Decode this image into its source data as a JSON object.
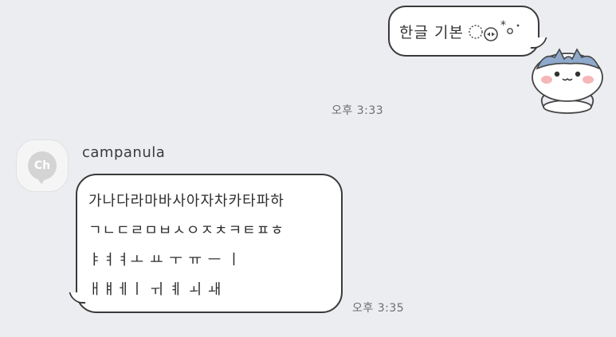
{
  "outgoing": {
    "text": "한글 기본",
    "kaomoji_star": "*",
    "time": "오후 3:33"
  },
  "incoming": {
    "sender": "campanula",
    "avatar_text": "Ch",
    "lines": [
      "가나다라마바사아자차카타파하",
      "ㄱㄴㄷㄹㅁㅂㅅㅇㅈㅊㅋㅌㅍㅎ",
      "ㅑㅕㅕㅗ ㅛ ㅜ ㅠ ㅡ ㅣ",
      "ㅐㅒㅔㅣ ㅟ ㅖ ㅚ ㅙ"
    ],
    "time": "오후 3:35"
  },
  "colors": {
    "background": "#ebedf1",
    "bubble": "#ffffff",
    "outline": "#3a3a3a"
  }
}
